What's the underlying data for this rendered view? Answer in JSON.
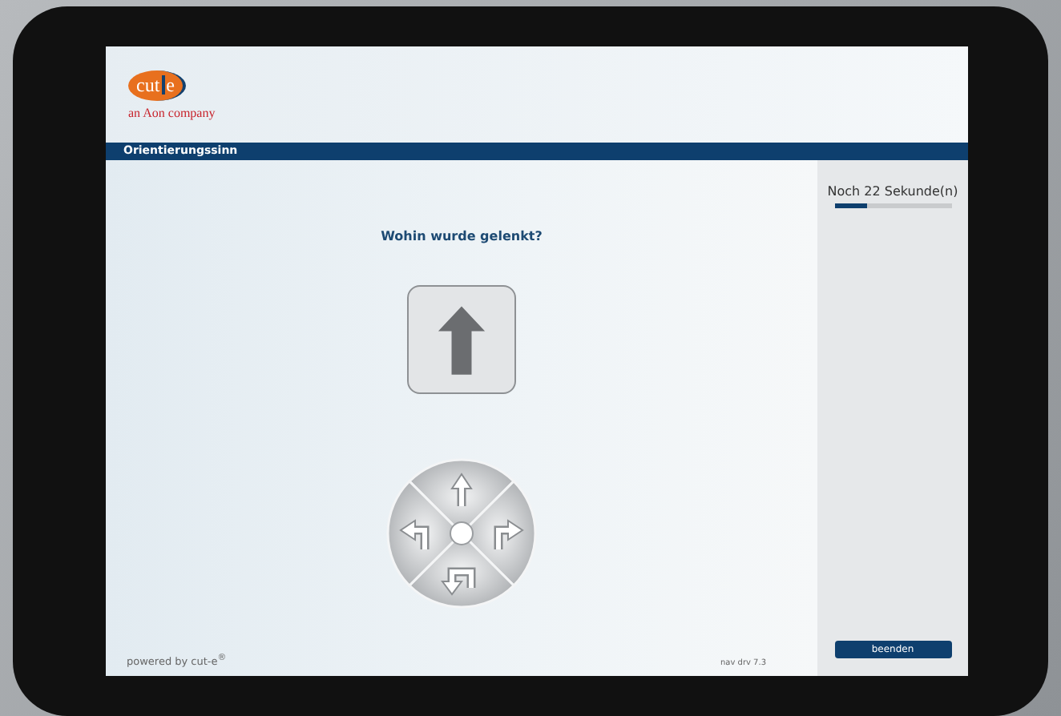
{
  "logo": {
    "part_1": "cut",
    "part_2": "e",
    "tagline": "an Aon company"
  },
  "title_bar": {
    "title": "Orientierungssinn"
  },
  "task": {
    "question": "Wohin wurde gelenkt?",
    "shown_arrow": {
      "kind": "straight"
    }
  },
  "dial": {
    "segments": [
      {
        "kind": "straight"
      },
      {
        "kind": "right"
      },
      {
        "kind": "back"
      },
      {
        "kind": "left"
      }
    ]
  },
  "sidebar": {
    "timer": "Noch 22 Sekunde(n)",
    "level": 0.28,
    "end_button": "beenden"
  },
  "footer": {
    "powered_by": "powered by cut-e$^{®}$",
    "version": "nav drv 7.3"
  }
}
